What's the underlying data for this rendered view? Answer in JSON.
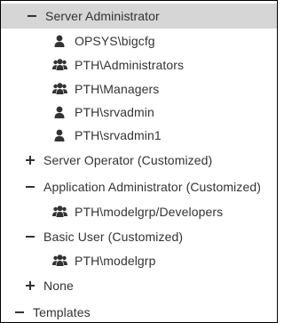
{
  "tree": {
    "nodes": [
      {
        "kind": "group",
        "state": "expanded",
        "label": "Server Administrator",
        "selected": true
      },
      {
        "kind": "user",
        "icon": "user-icon",
        "label": "OPSYS\\bigcfg"
      },
      {
        "kind": "user",
        "icon": "users-group-icon",
        "label": "PTH\\Administrators"
      },
      {
        "kind": "user",
        "icon": "users-group-icon",
        "label": "PTH\\Managers"
      },
      {
        "kind": "user",
        "icon": "user-icon",
        "label": "PTH\\srvadmin"
      },
      {
        "kind": "user",
        "icon": "user-icon",
        "label": "PTH\\srvadmin1"
      },
      {
        "kind": "group",
        "state": "collapsed",
        "label": "Server Operator (Customized)"
      },
      {
        "kind": "group",
        "state": "expanded",
        "label": "Application Administrator (Customized)"
      },
      {
        "kind": "user",
        "icon": "users-group-icon",
        "label": "PTH\\modelgrp/Developers"
      },
      {
        "kind": "group",
        "state": "expanded",
        "label": "Basic User (Customized)"
      },
      {
        "kind": "user",
        "icon": "users-group-icon",
        "label": "PTH\\modelgrp"
      },
      {
        "kind": "group",
        "state": "collapsed",
        "label": "None"
      },
      {
        "kind": "root",
        "state": "expanded",
        "label": "Templates"
      }
    ]
  },
  "colors": {
    "text": "#333333",
    "selected_background": "#d6d6d6",
    "border": "#000000"
  }
}
